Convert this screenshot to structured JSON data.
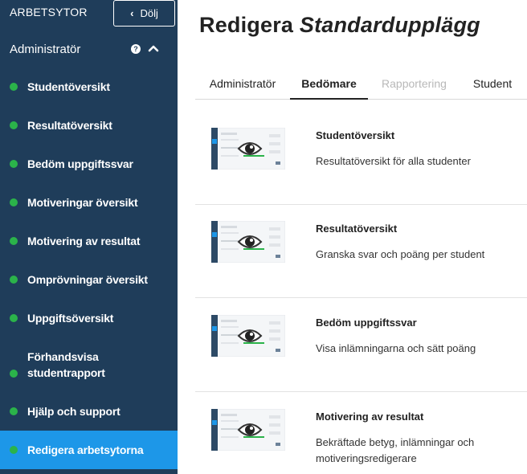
{
  "sidebar": {
    "title": "ARBETSYTOR",
    "hide_button": "Dölj",
    "section_label": "Administratör",
    "items": [
      {
        "label": "Studentöversikt"
      },
      {
        "label": "Resultatöversikt"
      },
      {
        "label": "Bedöm uppgiftssvar"
      },
      {
        "label": "Motiveringar översikt"
      },
      {
        "label": "Motivering av resultat"
      },
      {
        "label": "Omprövningar översikt"
      },
      {
        "label": "Uppgiftsöversikt"
      },
      {
        "label": "Förhandsvisa studentrapport"
      },
      {
        "label": "Hjälp och support"
      },
      {
        "label": "Redigera arbetsytorna"
      }
    ],
    "dot_color": "#2bb34a",
    "active_color": "#1d97e8",
    "background": "#1f3d5a"
  },
  "main": {
    "title_prefix": "Redigera",
    "title_name": "Standardupplägg",
    "tabs": [
      {
        "label": "Administratör",
        "state": "normal"
      },
      {
        "label": "Bedömare",
        "state": "active"
      },
      {
        "label": "Rapportering",
        "state": "disabled"
      },
      {
        "label": "Student",
        "state": "normal"
      }
    ],
    "cards": [
      {
        "title": "Studentöversikt",
        "description": "Resultatöversikt för alla studenter",
        "icon": "eye-icon"
      },
      {
        "title": "Resultatöversikt",
        "description": "Granska svar och poäng per student",
        "icon": "eye-icon"
      },
      {
        "title": "Bedöm uppgiftssvar",
        "description": "Visa inlämningarna och sätt poäng",
        "icon": "eye-icon"
      },
      {
        "title": "Motivering av resultat",
        "description": "Bekräftade betyg, inlämningar och motiveringsredigerare",
        "icon": "eye-icon"
      }
    ]
  }
}
